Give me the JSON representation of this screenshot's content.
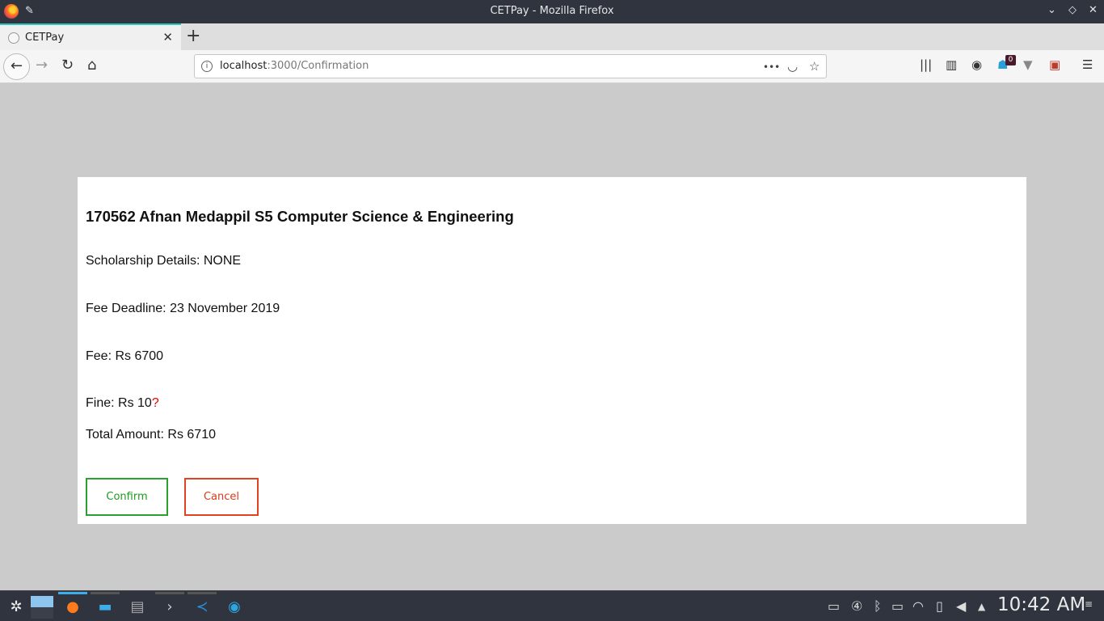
{
  "window": {
    "title": "CETPay - Mozilla Firefox",
    "pin_icon": "pin-icon",
    "minimize_glyph": "⌄",
    "maximize_glyph": "◇",
    "close_glyph": "✕"
  },
  "tab": {
    "title": "CETPay",
    "close_glyph": "✕",
    "new_tab_glyph": "+"
  },
  "navbar": {
    "back_glyph": "←",
    "forward_glyph": "→",
    "reload_glyph": "↻",
    "home_glyph": "⌂",
    "url_host": "localhost",
    "url_path": ":3000/Confirmation",
    "more_glyph": "•••",
    "pocket_glyph": "◡",
    "bookmark_glyph": "☆",
    "extension_badge": "0",
    "menu_glyph": "☰"
  },
  "student": {
    "heading": "170562 Afnan Medappil S5 Computer Science & Engineering",
    "scholarship": "Scholarship Details: NONE",
    "deadline": "Fee Deadline: 23 November 2019",
    "fee": "Fee: Rs 6700",
    "fine": "Fine: Rs 10",
    "fine_help": "?",
    "total": "Total Amount: Rs 6710"
  },
  "actions": {
    "confirm_label": "Confirm",
    "cancel_label": "Cancel"
  },
  "colors": {
    "confirm": "#2ca02c",
    "cancel": "#e0431f",
    "page_background": "#cbcbcb"
  },
  "taskbar": {
    "clock": "10:42 AM",
    "virtual_desktop": "④"
  }
}
